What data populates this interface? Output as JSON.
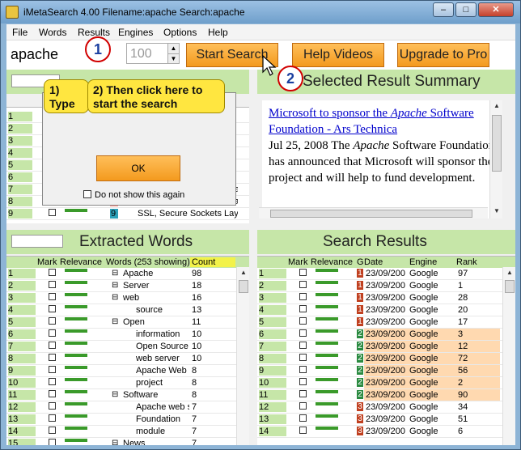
{
  "window": {
    "title": "iMetaSearch 4.00  Filename:apache  Search:apache"
  },
  "menu": [
    "File",
    "Words",
    "Results",
    "Engines",
    "Options",
    "Help"
  ],
  "toolbar": {
    "query": "apache",
    "count": "100",
    "start_search": "Start Search",
    "help_videos": "Help Videos",
    "upgrade": "Upgrade to Pro",
    "marker1": "1",
    "marker2": "2"
  },
  "dialog": {
    "callout1": "1) Type keyword or phrase",
    "callout2": "2) Then click here to start the search",
    "ok": "OK",
    "checkbox": "Do not show this again"
  },
  "top_left_rows": [
    {
      "n": "1"
    },
    {
      "n": "2"
    },
    {
      "n": "3"
    },
    {
      "n": "4"
    },
    {
      "n": "5"
    },
    {
      "n": "6"
    },
    {
      "n": "7",
      "tag": "7",
      "tag_color": "#ffd6b0",
      "text": "Apache Junction, AZ, Apa"
    },
    {
      "n": "8",
      "tag": "8",
      "tag_color": "#ff8c80",
      "text": "Definitive Guide, Peter Lau"
    },
    {
      "n": "9",
      "tag": "9",
      "tag_color": "#2aa0b8",
      "text": "SSL, Secure Sockets Lay"
    }
  ],
  "summary": {
    "title": "Selected Result Summary",
    "link1": "Microsoft to sponsor the ",
    "link_em": "Apache",
    "link2": " Software Foundation - Ars Technica",
    "date_text": "Jul 25, 2008 The ",
    "date_em": "Apache",
    "body": " Software Foundation has announced that Microsoft will sponsor the project and will help to fund development."
  },
  "extracted": {
    "title": "Extracted Words",
    "headers": {
      "mark": "Mark",
      "relevance": "Relevance",
      "words": "Words (253 showing)",
      "count": "Count"
    },
    "rows": [
      {
        "n": "1",
        "word": "Apache",
        "count": "98",
        "exp": "⊟"
      },
      {
        "n": "2",
        "word": "Server",
        "count": "18",
        "exp": "⊟"
      },
      {
        "n": "3",
        "word": "web",
        "count": "16",
        "exp": "⊟"
      },
      {
        "n": "4",
        "word": "source",
        "count": "13",
        "exp": ""
      },
      {
        "n": "5",
        "word": "Open",
        "count": "11",
        "exp": "⊟"
      },
      {
        "n": "6",
        "word": "information",
        "count": "10",
        "exp": ""
      },
      {
        "n": "7",
        "word": "Open Source",
        "count": "10",
        "exp": ""
      },
      {
        "n": "8",
        "word": "web server",
        "count": "10",
        "exp": ""
      },
      {
        "n": "9",
        "word": "Apache Web",
        "count": "8",
        "exp": ""
      },
      {
        "n": "10",
        "word": "project",
        "count": "8",
        "exp": ""
      },
      {
        "n": "11",
        "word": "Software",
        "count": "8",
        "exp": "⊟"
      },
      {
        "n": "12",
        "word": "Apache web serve",
        "count": "7",
        "exp": ""
      },
      {
        "n": "13",
        "word": "Foundation",
        "count": "7",
        "exp": ""
      },
      {
        "n": "14",
        "word": "module",
        "count": "7",
        "exp": ""
      },
      {
        "n": "15",
        "word": "News",
        "count": "7",
        "exp": "⊟"
      }
    ]
  },
  "results": {
    "title": "Search Results",
    "headers": {
      "mark": "Mark",
      "relevance": "Relevance",
      "g": "G",
      "date": "Date",
      "engine": "Engine",
      "rank": "Rank"
    },
    "rows": [
      {
        "n": "1",
        "g": "1",
        "g_color": "#c04020",
        "date": "23/09/200",
        "engine": "Google",
        "rank": "97",
        "hl": false
      },
      {
        "n": "2",
        "g": "1",
        "g_color": "#c04020",
        "date": "23/09/200",
        "engine": "Google",
        "rank": "1",
        "hl": false
      },
      {
        "n": "3",
        "g": "1",
        "g_color": "#c04020",
        "date": "23/09/200",
        "engine": "Google",
        "rank": "28",
        "hl": false
      },
      {
        "n": "4",
        "g": "1",
        "g_color": "#c04020",
        "date": "23/09/200",
        "engine": "Google",
        "rank": "20",
        "hl": false
      },
      {
        "n": "5",
        "g": "1",
        "g_color": "#c04020",
        "date": "23/09/200",
        "engine": "Google",
        "rank": "17",
        "hl": false
      },
      {
        "n": "6",
        "g": "2",
        "g_color": "#2a8a40",
        "date": "23/09/200",
        "engine": "Google",
        "rank": "3",
        "hl": true
      },
      {
        "n": "7",
        "g": "2",
        "g_color": "#2a8a40",
        "date": "23/09/200",
        "engine": "Google",
        "rank": "12",
        "hl": true
      },
      {
        "n": "8",
        "g": "2",
        "g_color": "#2a8a40",
        "date": "23/09/200",
        "engine": "Google",
        "rank": "72",
        "hl": true
      },
      {
        "n": "9",
        "g": "2",
        "g_color": "#2a8a40",
        "date": "23/09/200",
        "engine": "Google",
        "rank": "56",
        "hl": true
      },
      {
        "n": "10",
        "g": "2",
        "g_color": "#2a8a40",
        "date": "23/09/200",
        "engine": "Google",
        "rank": "2",
        "hl": true
      },
      {
        "n": "11",
        "g": "2",
        "g_color": "#2a8a40",
        "date": "23/09/200",
        "engine": "Google",
        "rank": "90",
        "hl": true
      },
      {
        "n": "12",
        "g": "3",
        "g_color": "#c04020",
        "date": "23/09/200",
        "engine": "Google",
        "rank": "34",
        "hl": false
      },
      {
        "n": "13",
        "g": "3",
        "g_color": "#c04020",
        "date": "23/09/200",
        "engine": "Google",
        "rank": "51",
        "hl": false
      },
      {
        "n": "14",
        "g": "3",
        "g_color": "#c04020",
        "date": "23/09/200",
        "engine": "Google",
        "rank": "6",
        "hl": false
      }
    ]
  },
  "colors": {
    "panel_green": "#c6e6a8",
    "orange": "#f39a1e",
    "highlight": "#ffd9b0",
    "relevance_bar": "#3a9a2a"
  }
}
